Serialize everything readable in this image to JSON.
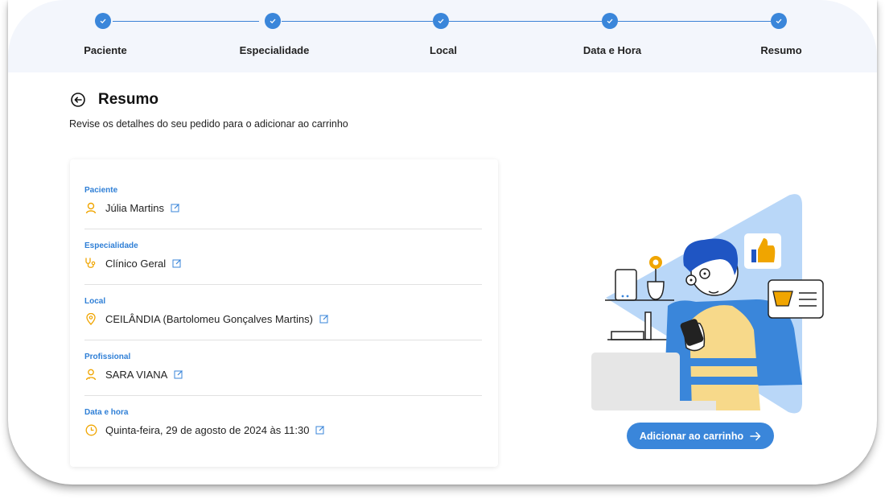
{
  "stepper": {
    "steps": [
      {
        "label": "Paciente"
      },
      {
        "label": "Especialidade"
      },
      {
        "label": "Local"
      },
      {
        "label": "Data e Hora"
      },
      {
        "label": "Resumo"
      }
    ]
  },
  "header": {
    "title": "Resumo",
    "subtitle": "Revise os detalhes do seu pedido para o adicionar ao carrinho"
  },
  "summary": {
    "sections": [
      {
        "label": "Paciente",
        "value": "Júlia Martins",
        "icon": "user-icon"
      },
      {
        "label": "Especialidade",
        "value": "Clínico Geral",
        "icon": "stethoscope-icon"
      },
      {
        "label": "Local",
        "value": "CEILÂNDIA (Bartolomeu Gonçalves Martins)",
        "icon": "location-pin-icon"
      },
      {
        "label": "Profissional",
        "value": "SARA VIANA",
        "icon": "doctor-icon"
      },
      {
        "label": "Data e hora",
        "value": "Quinta-feira, 29 de agosto de 2024 às 11:30",
        "icon": "clock-icon"
      }
    ]
  },
  "action": {
    "add_to_cart_label": "Adicionar ao carrinho"
  },
  "colors": {
    "accent": "#3a86da",
    "icon_accent": "#f0a500",
    "stepper_bg": "#f3f6fc"
  }
}
